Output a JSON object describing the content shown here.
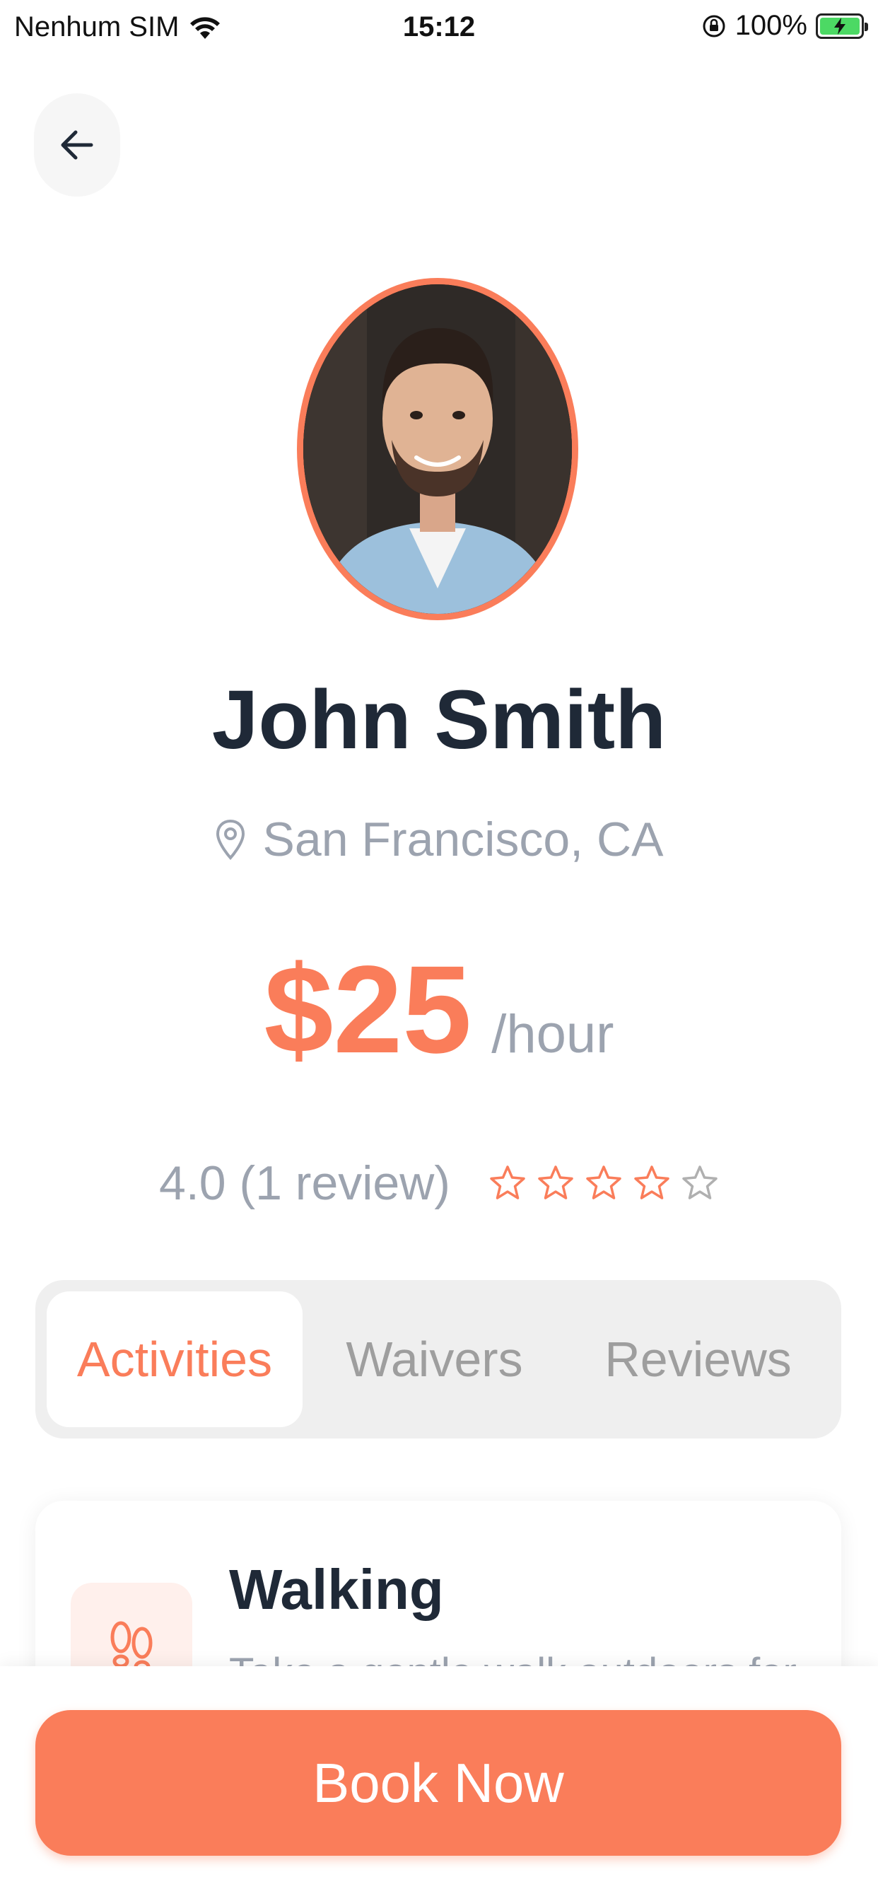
{
  "status_bar": {
    "carrier": "Nenhum SIM",
    "time": "15:12",
    "battery": "100%",
    "icons": [
      "wifi-icon",
      "lock-rotation-icon",
      "battery-charging-icon"
    ]
  },
  "header": {
    "back_icon": "arrow-left-icon"
  },
  "profile": {
    "name": "John Smith",
    "location": "San Francisco, CA",
    "location_icon": "map-pin-icon",
    "price": "$25",
    "price_unit": "/hour",
    "rating_text": "4.0 (1 review)",
    "rating_value": 4,
    "rating_max": 5
  },
  "tabs": {
    "items": [
      {
        "label": "Activities",
        "active": true
      },
      {
        "label": "Waivers",
        "active": false
      },
      {
        "label": "Reviews",
        "active": false
      }
    ]
  },
  "activity": {
    "title": "Walking",
    "description": "Take a gentle walk outdoors for",
    "icon": "footprints-icon"
  },
  "footer": {
    "book_label": "Book Now"
  },
  "colors": {
    "accent": "#fa7d5a",
    "text_dark": "#1f2937",
    "text_muted": "#9ca3af",
    "tab_bg": "#efefef"
  }
}
